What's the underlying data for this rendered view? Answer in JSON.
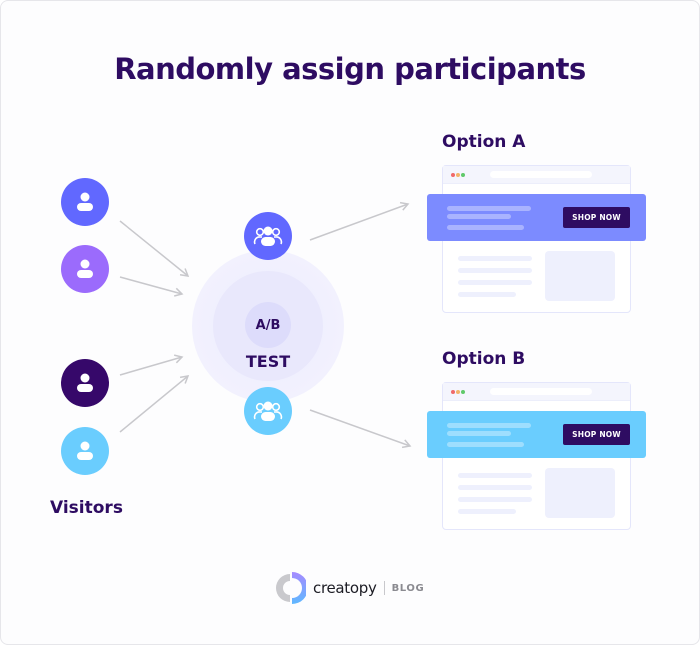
{
  "title": "Randomly assign participants",
  "visitors": {
    "label": "Visitors",
    "items": [
      {
        "name": "visitor-1",
        "color": "#6168ff",
        "icon": "user-icon"
      },
      {
        "name": "visitor-2",
        "color": "#9b6bfc",
        "icon": "user-icon"
      },
      {
        "name": "visitor-3",
        "color": "#36086a",
        "icon": "user-icon"
      },
      {
        "name": "visitor-4",
        "color": "#6acdfe",
        "icon": "user-icon"
      }
    ]
  },
  "test": {
    "badge": "A/B",
    "label": "TEST",
    "groups": [
      {
        "name": "group-a",
        "color": "#6168ff",
        "icon": "users-icon"
      },
      {
        "name": "group-b",
        "color": "#6acdfe",
        "icon": "users-icon"
      }
    ]
  },
  "options": [
    {
      "label": "Option A",
      "banner_color": "#7c8bff",
      "button_label": "SHOP NOW"
    },
    {
      "label": "Option B",
      "banner_color": "#6acdfe",
      "button_label": "SHOP NOW"
    }
  ],
  "colors": {
    "primary_text": "#2e0c62",
    "arrow": "#c8c8cc",
    "dot_red": "#f06a6a",
    "dot_yellow": "#f3b46a",
    "dot_green": "#5fc96a"
  },
  "footer": {
    "brand": "creatopy",
    "section": "BLOG"
  }
}
